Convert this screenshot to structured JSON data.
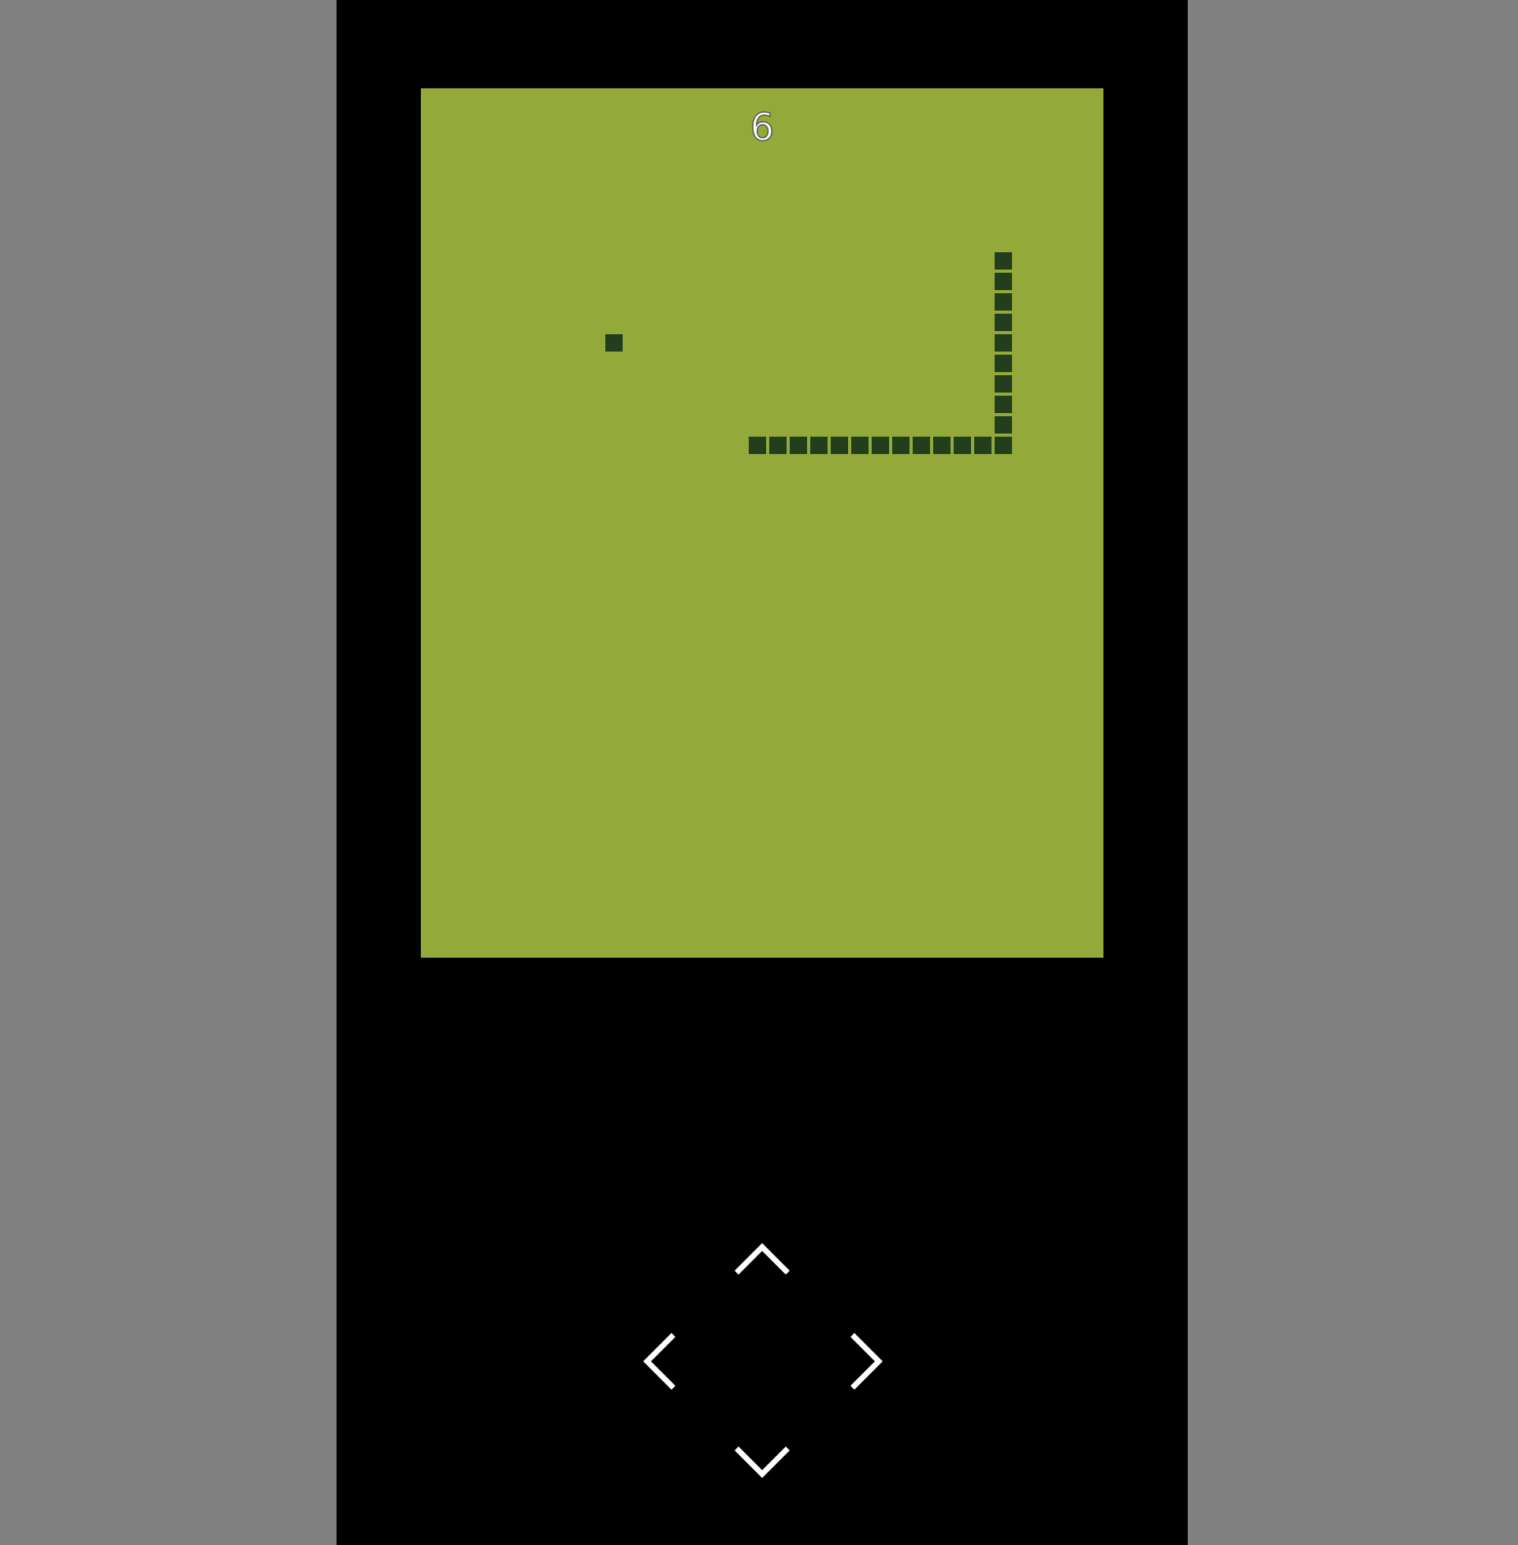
{
  "game": {
    "score": "6",
    "colors": {
      "background": "#808080",
      "device": "#000000",
      "screen": "#93a93a",
      "snake": "#223e1c",
      "food": "#223e1c",
      "controls": "#ffffff"
    },
    "grid": {
      "cols": 33,
      "rows": 42
    },
    "food": {
      "col": 9,
      "row": 12
    },
    "snake": [
      [
        28,
        8
      ],
      [
        28,
        9
      ],
      [
        28,
        10
      ],
      [
        28,
        11
      ],
      [
        28,
        12
      ],
      [
        28,
        13
      ],
      [
        28,
        14
      ],
      [
        28,
        15
      ],
      [
        28,
        16
      ],
      [
        28,
        17
      ],
      [
        27,
        17
      ],
      [
        26,
        17
      ],
      [
        25,
        17
      ],
      [
        24,
        17
      ],
      [
        23,
        17
      ],
      [
        22,
        17
      ],
      [
        21,
        17
      ],
      [
        20,
        17
      ],
      [
        19,
        17
      ],
      [
        18,
        17
      ],
      [
        17,
        17
      ],
      [
        16,
        17
      ]
    ]
  },
  "controls": {
    "up_icon": "chevron-up-icon",
    "left_icon": "chevron-left-icon",
    "right_icon": "chevron-right-icon",
    "down_icon": "chevron-down-icon"
  }
}
